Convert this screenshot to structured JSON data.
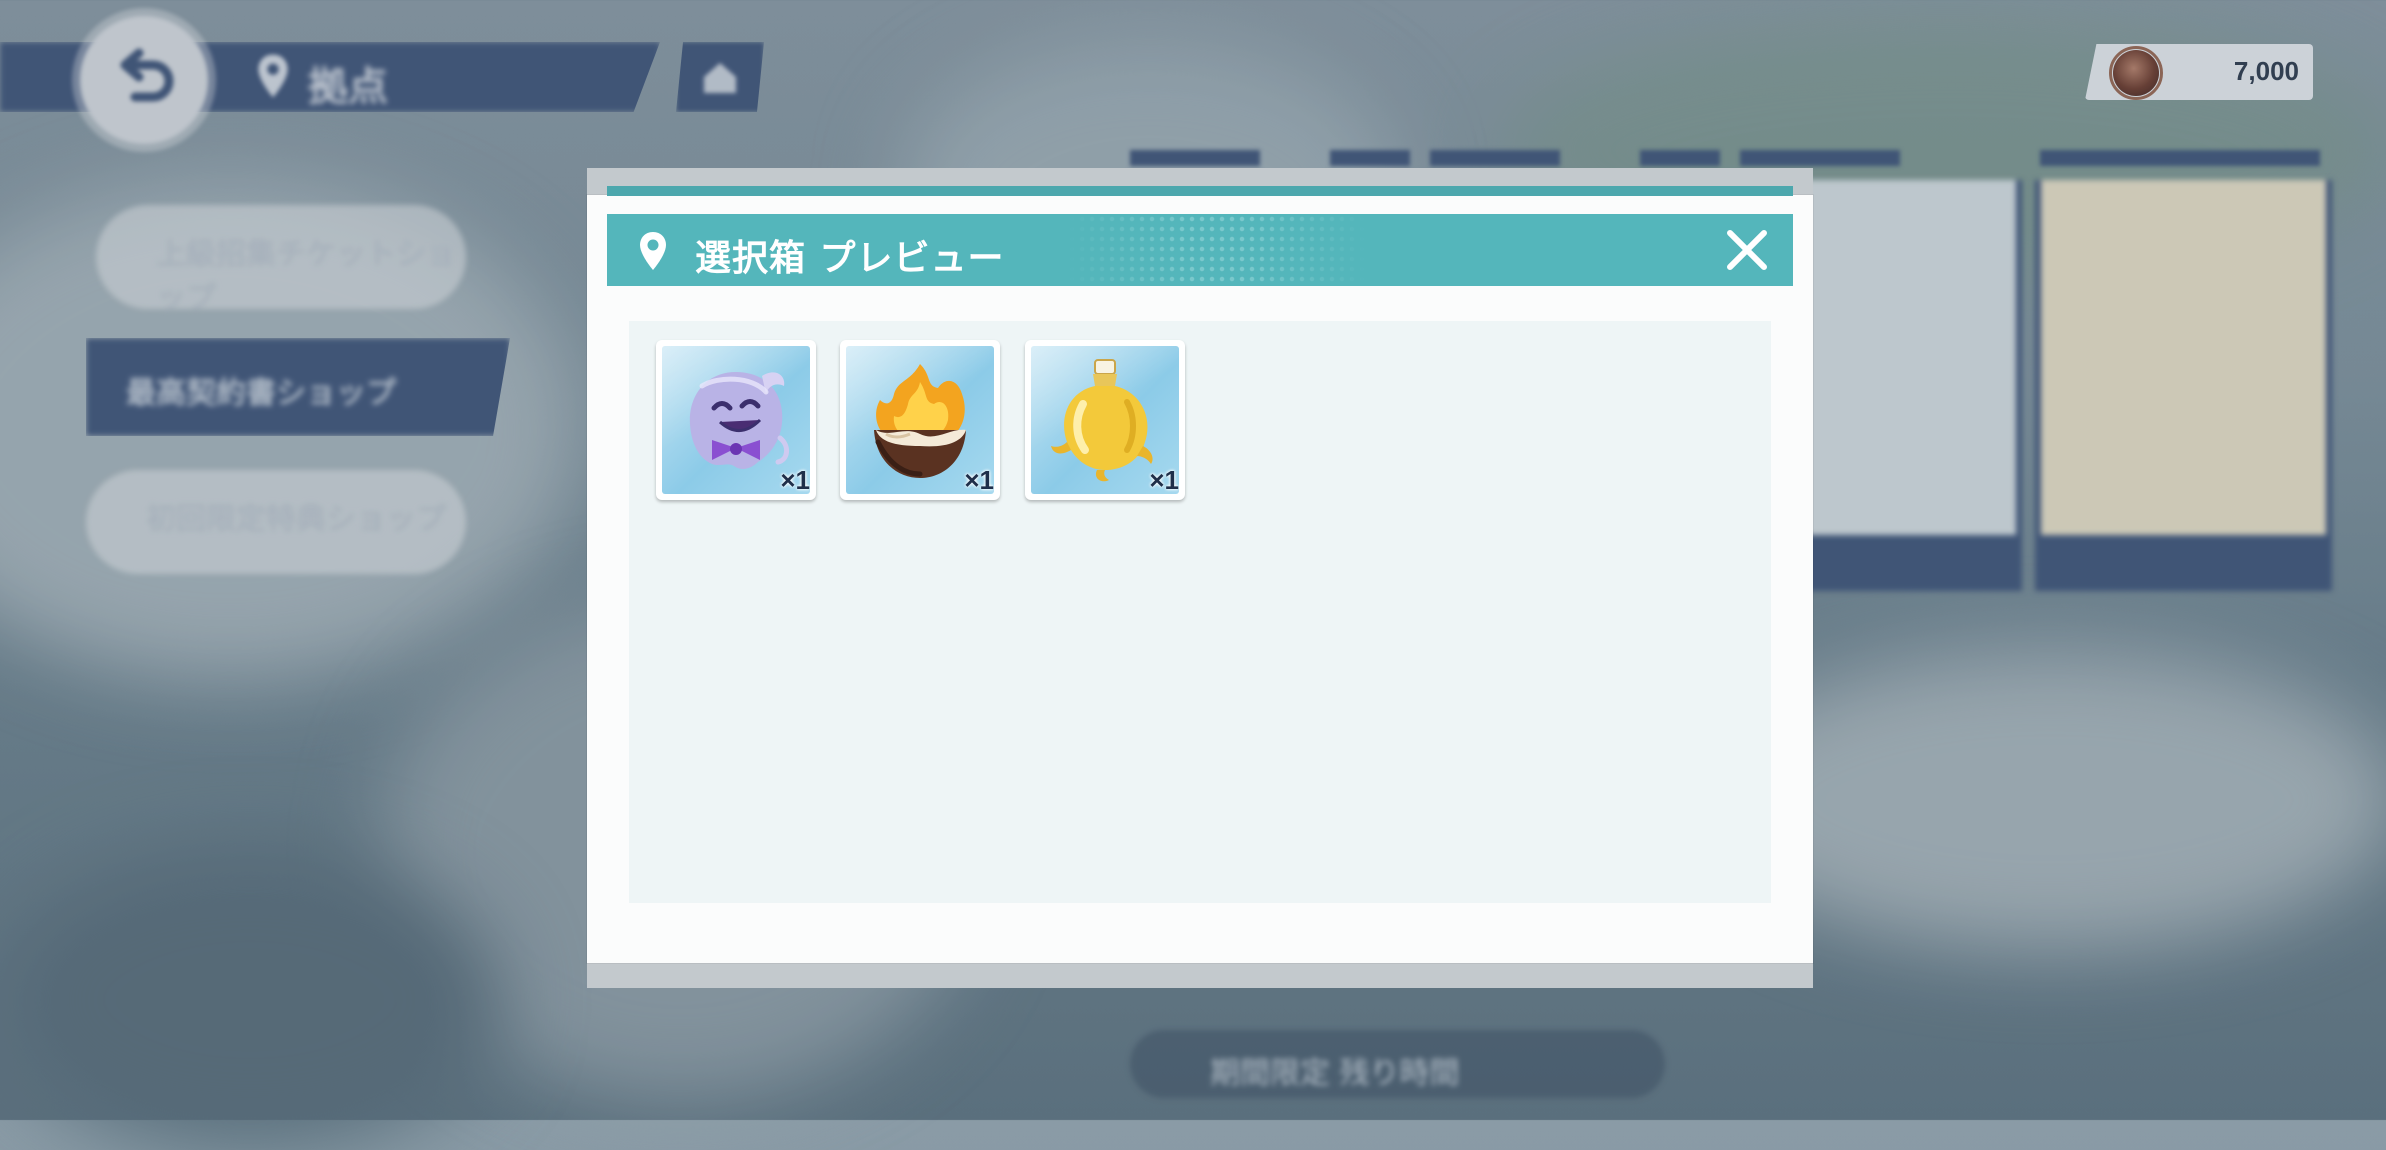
{
  "header": {
    "location_title": "拠点",
    "currency_value": "7,000",
    "currency_icon": "coin-icon"
  },
  "sidebar": {
    "items": [
      {
        "label": "上級招集チケットショップ"
      },
      {
        "label": "最高契約書ショップ"
      },
      {
        "label": "初回限定特典ショップ"
      }
    ]
  },
  "timer": {
    "label": "期間限定 残り時間"
  },
  "modal": {
    "title": "選択箱 プレビュー",
    "items": [
      {
        "name": "ghost-item-icon",
        "qty": "×1"
      },
      {
        "name": "flame-seed-item-icon",
        "qty": "×1"
      },
      {
        "name": "golden-flask-item-icon",
        "qty": "×1"
      }
    ]
  },
  "colors": {
    "header_teal": "#54b6bb",
    "navy": "#3f567b",
    "content_bg": "#eef5f6",
    "qty_text": "#1f2f4a"
  }
}
